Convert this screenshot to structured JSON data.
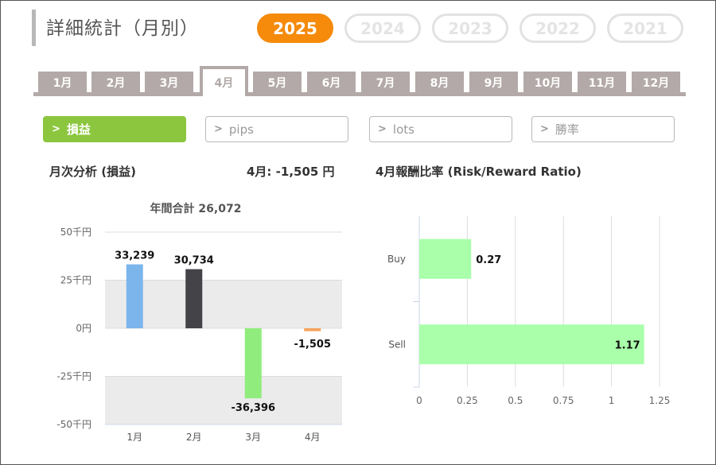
{
  "title": "詳細統計（月別）",
  "years": [
    "2025",
    "2024",
    "2023",
    "2022",
    "2021"
  ],
  "active_year": "2025",
  "months": [
    "1月",
    "2月",
    "3月",
    "4月",
    "5月",
    "6月",
    "7月",
    "8月",
    "9月",
    "10月",
    "11月",
    "12月"
  ],
  "active_month": "4月",
  "metrics": [
    {
      "label": "損益",
      "active": true
    },
    {
      "label": "pips",
      "active": false
    },
    {
      "label": "lots",
      "active": false
    },
    {
      "label": "勝率",
      "active": false
    }
  ],
  "monthly_section": {
    "title": "月次分析 (損益)",
    "month_summary": "4月:  -1,505 円"
  },
  "ratio_section": {
    "title": "4月報酬比率 (Risk/Reward Ratio)"
  },
  "colors": {
    "accent_orange": "#f58a0b",
    "active_green": "#8cc63f",
    "tab_gray": "#b3a9a8"
  },
  "chart_data": [
    {
      "type": "bar",
      "title": "年間合計 26,072",
      "categories": [
        "1月",
        "2月",
        "3月",
        "4月"
      ],
      "values": [
        33239,
        30734,
        -36396,
        -1505
      ],
      "value_labels": [
        "33,239",
        "30,734",
        "-36,396",
        "-1,505"
      ],
      "bar_colors": [
        "#7cb5ec",
        "#434348",
        "#90ed7d",
        "#f7a35c"
      ],
      "ylim": [
        -50000,
        50000
      ],
      "yticks": [
        50000,
        25000,
        0,
        -25000,
        -50000
      ],
      "ytick_labels": [
        "50千円",
        "25千円",
        "0円",
        "-25千円",
        "-50千円"
      ],
      "grid": true
    },
    {
      "type": "bar",
      "orientation": "horizontal",
      "categories": [
        "Buy",
        "Sell"
      ],
      "values": [
        0.27,
        1.17
      ],
      "value_labels": [
        "0.27",
        "1.17"
      ],
      "bar_color": "#aaffaa",
      "xlim": [
        0,
        1.25
      ],
      "xticks": [
        0,
        0.25,
        0.5,
        0.75,
        1,
        1.25
      ],
      "xtick_labels": [
        "0",
        "0.25",
        "0.5",
        "0.75",
        "1",
        "1.25"
      ],
      "grid": true
    }
  ]
}
